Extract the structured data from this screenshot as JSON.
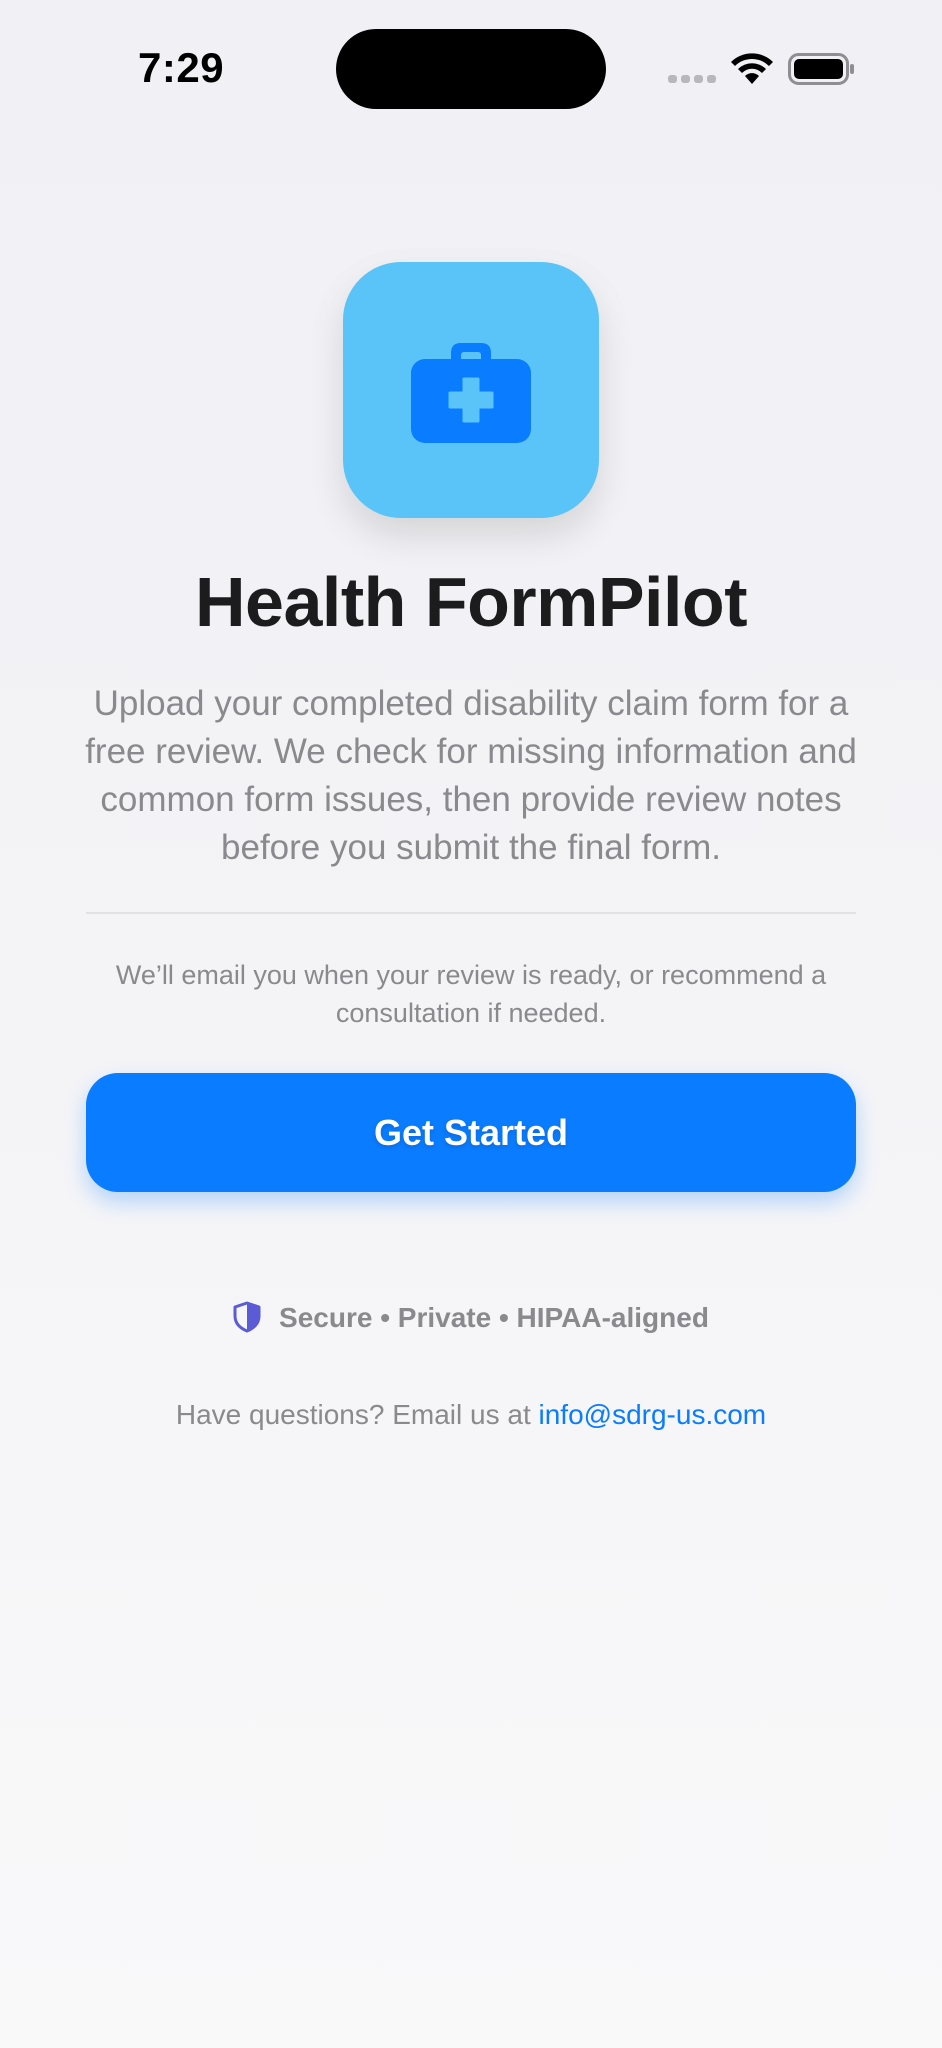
{
  "status_bar": {
    "time": "7:29",
    "icons": [
      "signal-icon",
      "wifi-icon",
      "battery-icon"
    ]
  },
  "app": {
    "icon": "medical-bag-icon",
    "title": "Health FormPilot",
    "description": "Upload your completed disability claim form for a free review. We check for missing information and common form issues, then provide review notes before you submit the final form.",
    "email_note": "We’ll email you when your review is ready, or recommend a consultation if needed."
  },
  "actions": {
    "get_started_label": "Get Started"
  },
  "security": {
    "icon": "shield-icon",
    "text": "Secure • Private • HIPAA-aligned"
  },
  "contact": {
    "prefix": "Have questions? Email us at",
    "email": "info@sdrg-us.com"
  },
  "colors": {
    "accent": "#0a7cff",
    "icon_background": "#5ac4f8",
    "shield": "#5b5bd6",
    "text_primary": "#1c1c1e",
    "text_secondary": "#8a8a8e"
  }
}
